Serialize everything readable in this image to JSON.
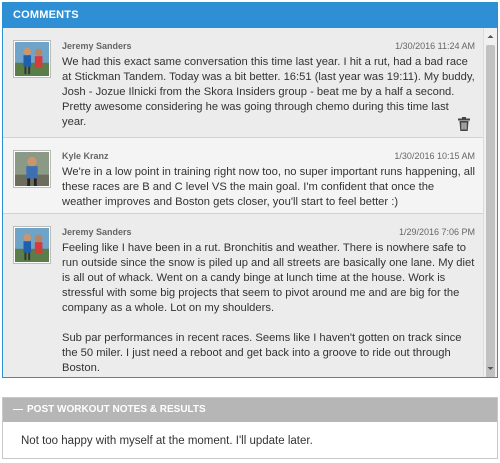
{
  "comments_panel": {
    "title": "COMMENTS",
    "comments": [
      {
        "author": "Jeremy Sanders",
        "timestamp": "1/30/2016 11:24 AM",
        "paragraphs": [
          "We had this exact same conversation this time last year. I hit a rut, had a bad race at Stickman Tandem. Today was a bit better. 16:51 (last year was 19:11). My buddy, Josh - Jozue Ilnicki from the Skora Insiders group - beat me by a half a second. Pretty awesome considering he was going through chemo during this time last year."
        ],
        "delete_icon": "trash-icon"
      },
      {
        "author": "Kyle Kranz",
        "timestamp": "1/30/2016 10:15 AM",
        "paragraphs": [
          "We're in a low point in training right now too, no super important runs happening, all these races are B and C level VS the main goal. I'm confident that once the weather improves and Boston gets closer, you'll start to feel better :)"
        ]
      },
      {
        "author": "Jeremy Sanders",
        "timestamp": "1/29/2016 7:06 PM",
        "paragraphs": [
          "Feeling like I have been in a rut. Bronchitis and weather. There is nowhere safe to run outside since the snow is piled up and all streets are basically one lane. My diet is all out of whack. Went on a candy binge at lunch time at the house. Work is stressful with some big projects that seem to pivot around me and are big for the company as a whole. Lot on my shoulders.",
          "Sub par performances in recent races. Seems like I haven't gotten on track since the 50 miler. I just need a reboot and get back into a groove to ride out through Boston."
        ]
      }
    ]
  },
  "notes_panel": {
    "collapse_symbol": "—",
    "title": "POST WORKOUT NOTES & RESULTS",
    "text": "Not too happy with myself at the moment. I'll update later."
  },
  "colors": {
    "header_blue": "#2f8fd4",
    "notes_header_gray": "#b6b6b6",
    "comment_bg": "#ececec"
  }
}
